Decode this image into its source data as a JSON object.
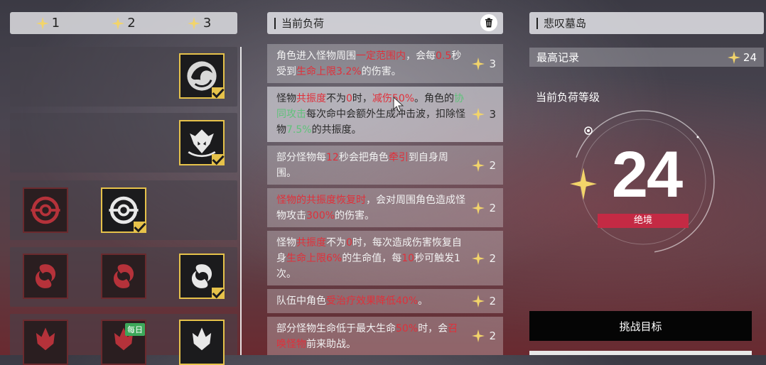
{
  "tiers": [
    "1",
    "2",
    "3"
  ],
  "load_panel": {
    "title": "当前负荷"
  },
  "island_panel": {
    "title": "悲叹墓岛"
  },
  "record": {
    "label": "最高记录",
    "value": "24"
  },
  "level": {
    "label": "当前负荷等级",
    "value": "24",
    "difficulty": "绝境"
  },
  "challenge_button": "挑战目标",
  "daily_badge": "每日",
  "effects": [
    {
      "cost": "3",
      "segments": [
        {
          "t": "角色进入怪物周围"
        },
        {
          "t": "一定范围内",
          "c": "r"
        },
        {
          "t": "，会每"
        },
        {
          "t": "0.5",
          "c": "r"
        },
        {
          "t": "秒受到"
        },
        {
          "t": "生命上限3.2%",
          "c": "r"
        },
        {
          "t": "的伤害。"
        }
      ]
    },
    {
      "cost": "3",
      "segments": [
        {
          "t": "怪物"
        },
        {
          "t": "共振度",
          "c": "r"
        },
        {
          "t": "不为"
        },
        {
          "t": "0",
          "c": "r"
        },
        {
          "t": "时，"
        },
        {
          "t": "减伤50%",
          "c": "r"
        },
        {
          "t": "。角色的"
        },
        {
          "t": "协同攻击",
          "c": "g"
        },
        {
          "t": "每次命中会额外生成冲击波，扣除怪物"
        },
        {
          "t": "7.5%",
          "c": "g"
        },
        {
          "t": "的共振度。"
        }
      ]
    },
    {
      "cost": "2",
      "segments": [
        {
          "t": "部分怪物每"
        },
        {
          "t": "12",
          "c": "r"
        },
        {
          "t": "秒会把角色"
        },
        {
          "t": "牵引",
          "c": "r"
        },
        {
          "t": "到自身周围。"
        }
      ]
    },
    {
      "cost": "2",
      "segments": [
        {
          "t": "怪物的共振度恢复时",
          "c": "r"
        },
        {
          "t": "，会对周围角色造成怪物攻击"
        },
        {
          "t": "300%",
          "c": "r"
        },
        {
          "t": "的伤害。"
        }
      ]
    },
    {
      "cost": "2",
      "segments": [
        {
          "t": "怪物"
        },
        {
          "t": "共振度",
          "c": "r"
        },
        {
          "t": "不为"
        },
        {
          "t": "0",
          "c": "r"
        },
        {
          "t": "时，每次造成伤害恢复自身"
        },
        {
          "t": "生命上限6%",
          "c": "r"
        },
        {
          "t": "的生命值，每"
        },
        {
          "t": "10",
          "c": "r"
        },
        {
          "t": "秒可触发1次。"
        }
      ]
    },
    {
      "cost": "2",
      "segments": [
        {
          "t": "队伍中角色"
        },
        {
          "t": "受治疗效果降低40%",
          "c": "r"
        },
        {
          "t": "。"
        }
      ]
    },
    {
      "cost": "2",
      "segments": [
        {
          "t": "部分怪物生命低于最大生命"
        },
        {
          "t": "50%",
          "c": "r"
        },
        {
          "t": "时，会"
        },
        {
          "t": "召唤怪物",
          "c": "r"
        },
        {
          "t": "前来助战。"
        }
      ]
    }
  ],
  "slot_icons": {
    "row1": [
      "dragon-icon"
    ],
    "row2": [
      "horned-mask-icon"
    ],
    "row3": [
      "reticle-icon",
      "reticle-icon"
    ],
    "row4": [
      "swirl-icon",
      "swirl-icon",
      "swirl-icon"
    ],
    "row5": [
      "flame-mask-icon",
      "flame-mask-icon",
      "flame-mask-icon"
    ]
  },
  "colors": {
    "gold": "#e6c24a",
    "red_text": "#e0303a",
    "green_text": "#5fc27a",
    "difficulty": "#c42a44"
  }
}
